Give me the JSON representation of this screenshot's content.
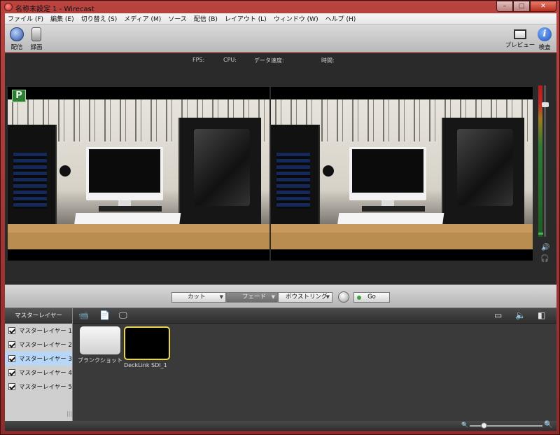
{
  "window": {
    "title": "名称未設定 1 - Wirecast"
  },
  "menu": [
    "ファイル (F)",
    "編集 (E)",
    "切り替え (S)",
    "メディア (M)",
    "ソース",
    "配信 (B)",
    "レイアウト (L)",
    "ウィンドウ (W)",
    "ヘルプ (H)"
  ],
  "toolbar": {
    "broadcast_label": "配信",
    "record_label": "録画",
    "preview_label": "プレビュー",
    "inspect_label": "検査"
  },
  "stats": {
    "fps": "FPS:",
    "cpu": "CPU:",
    "data_rate": "データ速度:",
    "time": "時間:"
  },
  "preview_badge": "P",
  "transition": {
    "cut": "カット",
    "fade": "フェード",
    "bowtie": "ボウストリング",
    "go": "Go"
  },
  "layers": {
    "header": "マスターレイヤー",
    "items": [
      "マスターレイヤー 1",
      "マスターレイヤー 2",
      "マスターレイヤー 3",
      "マスターレイヤー 4",
      "マスターレイヤー 5"
    ],
    "selected_index": 2
  },
  "shots": [
    {
      "label": "ブランクショット"
    },
    {
      "label": "DeckLink SDI_1"
    }
  ]
}
